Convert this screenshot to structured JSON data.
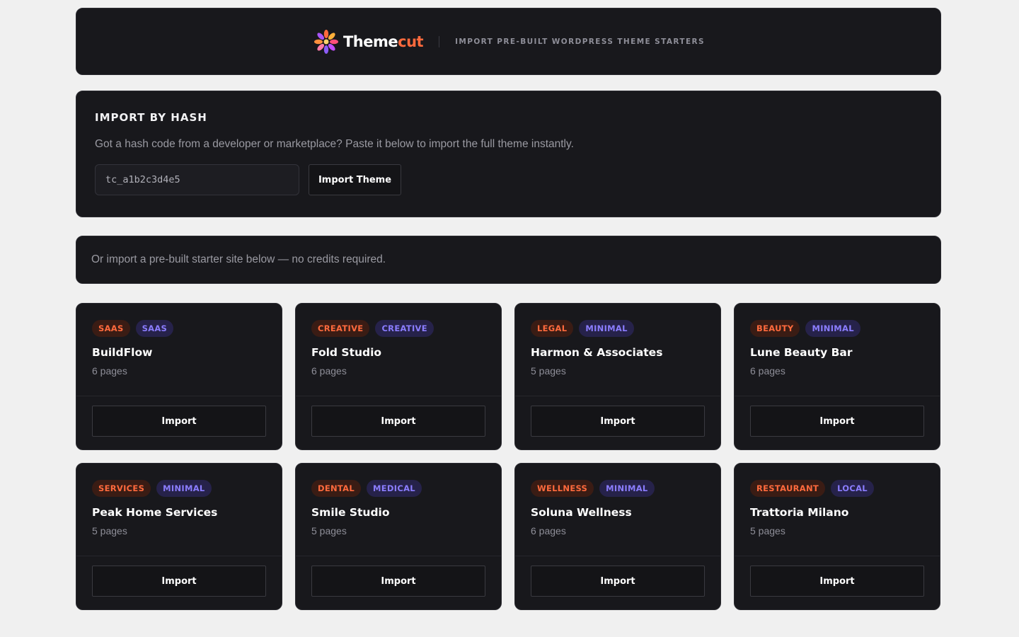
{
  "header": {
    "brand_part1": "Theme",
    "brand_part2": "cut",
    "tagline": "IMPORT PRE-BUILT WORDPRESS THEME STARTERS",
    "logo_icon": "flower-icon",
    "accent_color": "#ff6a3d"
  },
  "hash_import": {
    "title": "IMPORT BY HASH",
    "description": "Got a hash code from a developer or marketplace? Paste it below to import the full theme instantly.",
    "input_value": "tc_a1b2c3d4e5",
    "button_label": "Import Theme"
  },
  "notice": {
    "text": "Or import a pre-built starter site below — no credits required."
  },
  "starters": [
    {
      "tag1": "SAAS",
      "tag2": "SAAS",
      "title": "BuildFlow",
      "pages": "6 pages",
      "button": "Import"
    },
    {
      "tag1": "CREATIVE",
      "tag2": "CREATIVE",
      "title": "Fold Studio",
      "pages": "6 pages",
      "button": "Import"
    },
    {
      "tag1": "LEGAL",
      "tag2": "MINIMAL",
      "title": "Harmon & Associates",
      "pages": "5 pages",
      "button": "Import"
    },
    {
      "tag1": "BEAUTY",
      "tag2": "MINIMAL",
      "title": "Lune Beauty Bar",
      "pages": "6 pages",
      "button": "Import"
    },
    {
      "tag1": "SERVICES",
      "tag2": "MINIMAL",
      "title": "Peak Home Services",
      "pages": "5 pages",
      "button": "Import"
    },
    {
      "tag1": "DENTAL",
      "tag2": "MEDICAL",
      "title": "Smile Studio",
      "pages": "5 pages",
      "button": "Import"
    },
    {
      "tag1": "WELLNESS",
      "tag2": "MINIMAL",
      "title": "Soluna Wellness",
      "pages": "6 pages",
      "button": "Import"
    },
    {
      "tag1": "RESTAURANT",
      "tag2": "LOCAL",
      "title": "Trattoria Milano",
      "pages": "5 pages",
      "button": "Import"
    }
  ]
}
